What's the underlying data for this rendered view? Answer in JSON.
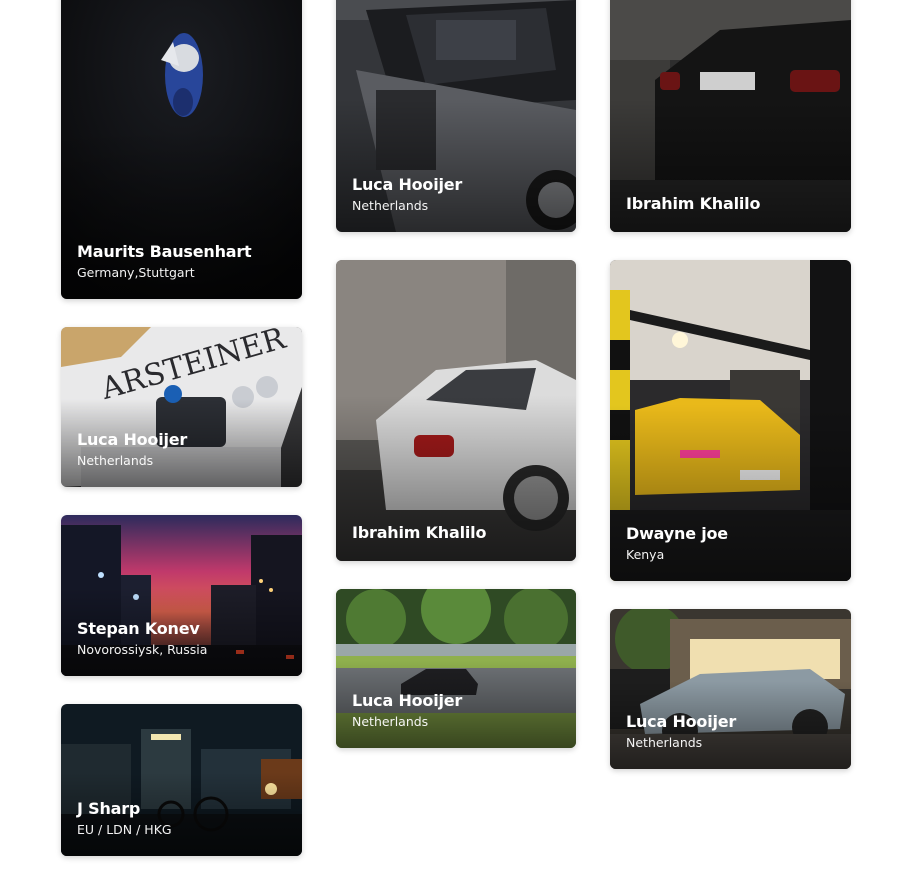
{
  "cards": [
    {
      "name": "Maurits Bausenhart",
      "location": "Germany,Stuttgart",
      "scene": "dark-studio-motorcycle"
    },
    {
      "name": "Luca Hooijer",
      "location": "Netherlands",
      "scene": "white-bmw-e30-front"
    },
    {
      "name": "Stepan Konev",
      "location": "Novorossiysk, Russia",
      "scene": "city-street-dusk"
    },
    {
      "name": "J Sharp",
      "location": "EU / LDN / HKG",
      "scene": "night-street-rickshaw"
    },
    {
      "name": "Luca Hooijer",
      "location": "Netherlands",
      "scene": "engine-bay"
    },
    {
      "name": "Ibrahim Khalilo",
      "location": "",
      "scene": "white-bmw-rear"
    },
    {
      "name": "Luca Hooijer",
      "location": "Netherlands",
      "scene": "car-on-track"
    },
    {
      "name": "Ibrahim Khalilo",
      "location": "",
      "scene": "black-sedan-rear"
    },
    {
      "name": "Dwayne joe",
      "location": "Kenya",
      "scene": "yellow-car-garage"
    },
    {
      "name": "Luca Hooijer",
      "location": "Netherlands",
      "scene": "ferrari-night"
    }
  ]
}
